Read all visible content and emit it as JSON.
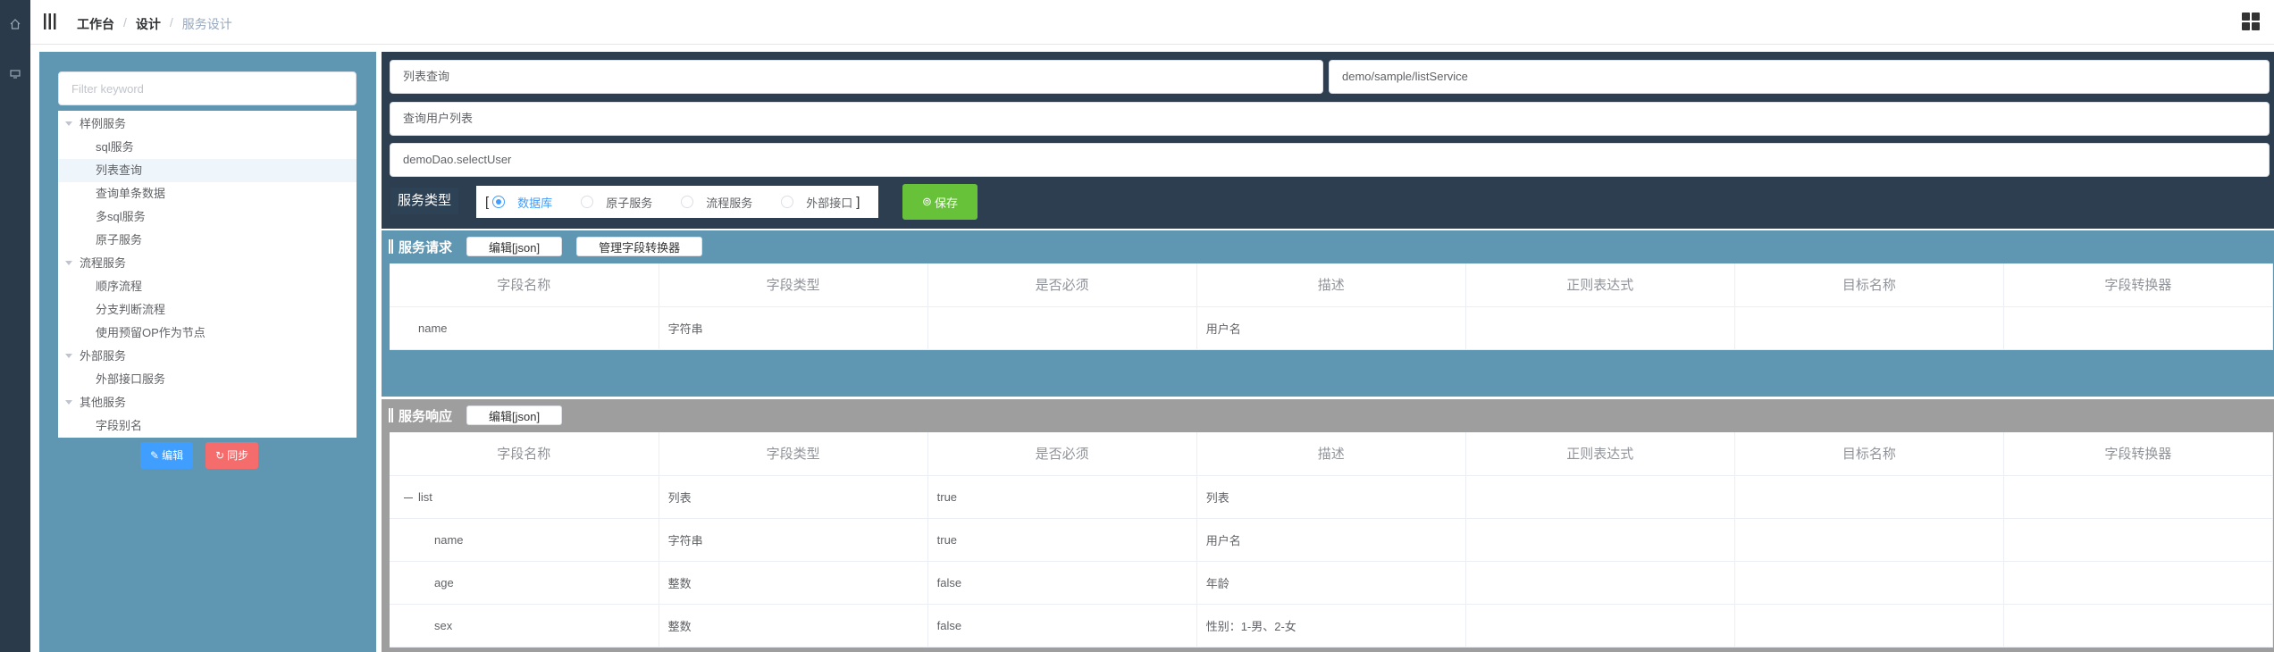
{
  "breadcrumb": {
    "home": "工作台",
    "design": "设计",
    "current": "服务设计"
  },
  "tree": {
    "filter_placeholder": "Filter keyword",
    "nodes": [
      {
        "label": "样例服务",
        "level": 1
      },
      {
        "label": "sql服务",
        "level": 2
      },
      {
        "label": "列表查询",
        "level": 2
      },
      {
        "label": "查询单条数据",
        "level": 2
      },
      {
        "label": "多sql服务",
        "level": 2
      },
      {
        "label": "原子服务",
        "level": 2
      },
      {
        "label": "流程服务",
        "level": 1
      },
      {
        "label": "顺序流程",
        "level": 2
      },
      {
        "label": "分支判断流程",
        "level": 2
      },
      {
        "label": "使用预留OP作为节点",
        "level": 2
      },
      {
        "label": "外部服务",
        "level": 1
      },
      {
        "label": "外部接口服务",
        "level": 2
      },
      {
        "label": "其他服务",
        "level": 1
      },
      {
        "label": "字段别名",
        "level": 2
      }
    ],
    "edit_label": "编辑",
    "sync_label": "同步"
  },
  "form": {
    "service_name": "列表查询",
    "service_path": "demo/sample/listService",
    "description": "查询用户列表",
    "dao_method": "demoDao.selectUser",
    "service_type_label": "服务类型",
    "bracket_open": "[",
    "bracket_close": "]",
    "types": [
      "数据库",
      "原子服务",
      "流程服务",
      "外部接口"
    ],
    "save_label": "保存"
  },
  "request": {
    "title": "服务请求",
    "edit_json": "编辑[json]",
    "manage_converter": "管理字段转换器",
    "columns": [
      "字段名称",
      "字段类型",
      "是否必须",
      "描述",
      "正则表达式",
      "目标名称",
      "字段转换器"
    ],
    "rows": [
      {
        "name": "name",
        "type": "字符串",
        "required": "",
        "desc": "用户名",
        "regex": "",
        "target": "",
        "converter": ""
      }
    ]
  },
  "response": {
    "title": "服务响应",
    "edit_json": "编辑[json]",
    "columns": [
      "字段名称",
      "字段类型",
      "是否必须",
      "描述",
      "正则表达式",
      "目标名称",
      "字段转换器"
    ],
    "rows": [
      {
        "name": "list",
        "type": "列表",
        "required": "true",
        "desc": "列表",
        "regex": "",
        "target": "",
        "converter": ""
      },
      {
        "name": "name",
        "type": "字符串",
        "required": "true",
        "desc": "用户名",
        "regex": "",
        "target": "",
        "converter": ""
      },
      {
        "name": "age",
        "type": "整数",
        "required": "false",
        "desc": "年龄",
        "regex": "",
        "target": "",
        "converter": ""
      },
      {
        "name": "sex",
        "type": "整数",
        "required": "false",
        "desc": "性别：1-男、2-女",
        "regex": "",
        "target": "",
        "converter": ""
      }
    ]
  }
}
